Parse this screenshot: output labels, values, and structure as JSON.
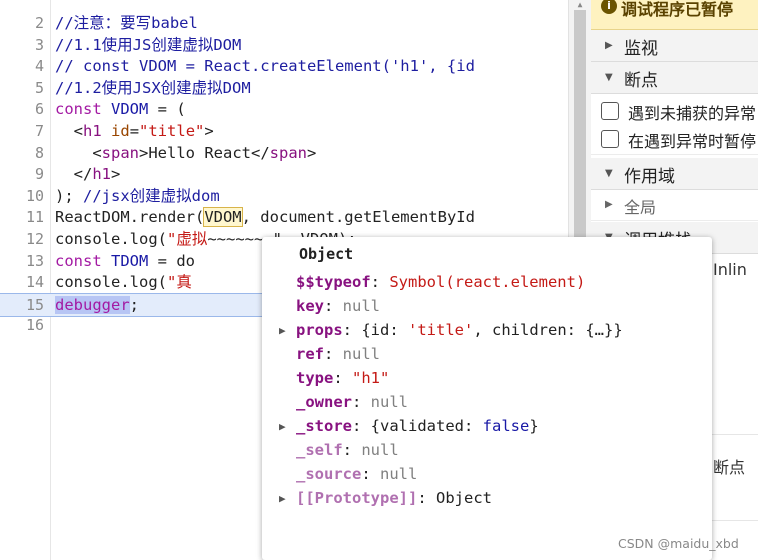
{
  "editor": {
    "lines": [
      {
        "n": "2",
        "text": "//注意：要写babel"
      },
      {
        "n": "3",
        "text": "//1.1使用JS创建虚拟DOM"
      },
      {
        "n": "4",
        "text": "// const VDOM = React.createElement('h1', {id"
      },
      {
        "n": "5",
        "text": "//1.2使用JSX创建虚拟DOM"
      },
      {
        "n": "6",
        "kw": "const ",
        "var": "VDOM",
        "rest": " = ("
      },
      {
        "n": "7",
        "pre": "  <",
        "tag": "h1",
        "sp": " ",
        "attr": "id",
        "eq": "=",
        "str": "\"title\"",
        "post": ">"
      },
      {
        "n": "8",
        "pre": "    <",
        "tag": "span",
        "post": ">Hello React</",
        "tag2": "span",
        "post2": ">"
      },
      {
        "n": "9",
        "pre": "  </",
        "tag": "h1",
        "post": ">"
      },
      {
        "n": "10",
        "pre": "); ",
        "comment": "//jsx创建虚拟dom"
      },
      {
        "n": "11",
        "pre": "ReactDOM.render(",
        "box": "VDOM",
        "post": ", document.getElementById"
      },
      {
        "n": "12",
        "pre": "console.log(",
        "str": "\"虚拟",
        "post": "~~~~~~~\", VDOM);"
      },
      {
        "n": "13",
        "kw": "const ",
        "var": "TDOM",
        "rest": " = do"
      },
      {
        "n": "14",
        "pre": "console.log(",
        "str": "\"真"
      },
      {
        "n": "15",
        "sel": "debugger",
        "post": ";"
      },
      {
        "n": "16",
        "text": ""
      }
    ]
  },
  "panel": {
    "paused_text": "调试程序已暂停",
    "watch_label": "监视",
    "breakpoints_label": "断点",
    "uncaught_label": "遇到未捕获的异常",
    "caught_label": "在遇到异常时暂停",
    "scope_label": "作用域",
    "global_label": "全局",
    "callstack_label": "调用堆栈",
    "inline_label": "Inlin",
    "breakpoint_label2": "断点"
  },
  "popover": {
    "title": "Object",
    "props": [
      {
        "key": "$$typeof",
        "value": "Symbol(react.element)",
        "vtype": "sym",
        "expandable": false,
        "dim": false
      },
      {
        "key": "key",
        "value": "null",
        "vtype": "null",
        "expandable": false,
        "dim": false
      },
      {
        "key": "props",
        "value": "{id: 'title', children: {…}}",
        "vtype": "obj",
        "expandable": true,
        "dim": false
      },
      {
        "key": "ref",
        "value": "null",
        "vtype": "null",
        "expandable": false,
        "dim": false
      },
      {
        "key": "type",
        "value": "\"h1\"",
        "vtype": "str",
        "expandable": false,
        "dim": false
      },
      {
        "key": "_owner",
        "value": "null",
        "vtype": "null",
        "expandable": false,
        "dim": false
      },
      {
        "key": "_store",
        "value": "{validated: false}",
        "vtype": "obj",
        "expandable": true,
        "dim": false
      },
      {
        "key": "_self",
        "value": "null",
        "vtype": "null",
        "expandable": false,
        "dim": true
      },
      {
        "key": "_source",
        "value": "null",
        "vtype": "null",
        "expandable": false,
        "dim": true
      },
      {
        "key": "[[Prototype]]",
        "value": "Object",
        "vtype": "obj",
        "expandable": true,
        "dim": true
      }
    ]
  },
  "watermark": "CSDN @maidu_xbd"
}
